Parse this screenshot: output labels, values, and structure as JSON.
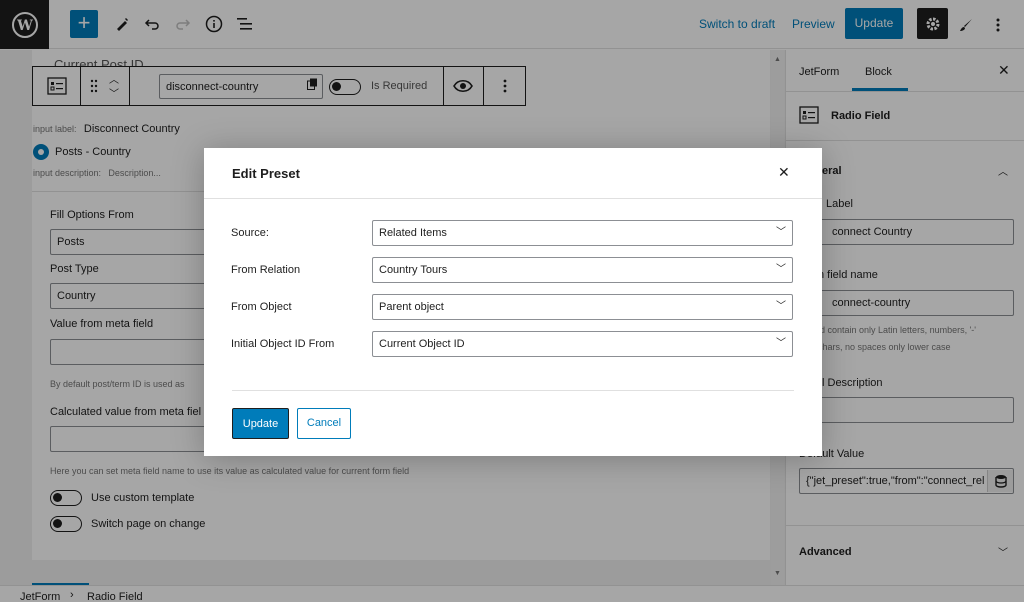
{
  "topbar": {
    "switch_to_draft": "Switch to draft",
    "preview": "Preview",
    "update": "Update"
  },
  "toolbar": {
    "field_name_value": "disconnect-country",
    "is_required_label": "Is Required"
  },
  "block": {
    "header_partial": "Current Post ID",
    "input_label_prefix": "input label:",
    "input_label_value": "Disconnect Country",
    "radio_option": "Posts - Country",
    "input_description_prefix": "input description:",
    "input_description_value": "Description...",
    "fill_options_label": "Fill Options From",
    "fill_options_value": "Posts",
    "post_type_label": "Post Type",
    "post_type_value": "Country",
    "value_meta_label": "Value from meta field",
    "value_meta_help": "By default post/term ID is used as",
    "calc_meta_label": "Calculated value from meta fiel",
    "calc_meta_help": "Here you can set meta field name to use its value as calculated value for current form field",
    "custom_template_label": "Use custom template",
    "switch_page_label": "Switch page on change"
  },
  "sidebar": {
    "tab_jetform": "JetForm",
    "tab_block": "Block",
    "block_name": "Radio Field",
    "general_partial": "eral",
    "label_partial": "Label",
    "label_value_partial": "connect Country",
    "name_partial": "n field name",
    "name_value_partial": "connect-country",
    "name_help_partial_1": "ld contain only Latin letters, numbers, '-'",
    "name_help_partial_2": "chars, no spaces only lower case",
    "desc_partial": "l Description",
    "default_partial": "Default Value",
    "default_value": "{\"jet_preset\":true,\"from\":\"connect_rel",
    "advanced": "Advanced"
  },
  "footer": {
    "crumb_1": "JetForm",
    "crumb_sep": "›",
    "crumb_2": "Radio Field"
  },
  "modal": {
    "title": "Edit Preset",
    "rows": [
      {
        "label": "Source:",
        "value": "Related Items"
      },
      {
        "label": "From Relation",
        "value": "Country Tours"
      },
      {
        "label": "From Object",
        "value": "Parent object"
      },
      {
        "label": "Initial Object ID From",
        "value": "Current Object ID"
      }
    ],
    "update": "Update",
    "cancel": "Cancel"
  },
  "colors": {
    "accent": "#007cba",
    "dark": "#1e1e1e"
  }
}
